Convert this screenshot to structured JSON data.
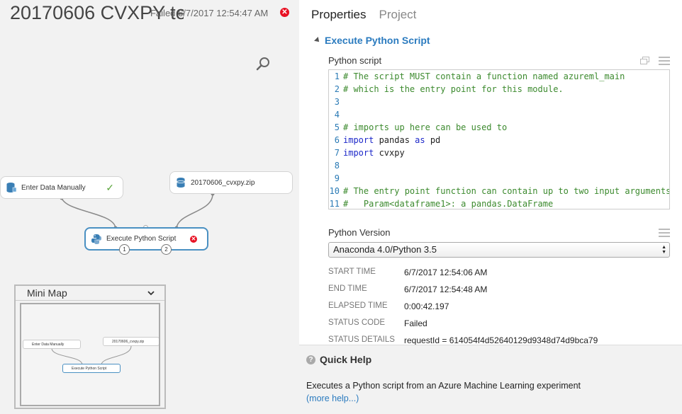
{
  "canvas": {
    "experiment_title": "20170606 CVXPY te..",
    "status_prefix": "Failed",
    "status_time": "6/7/2017 12:54:47 AM",
    "modules": {
      "enter_data": "Enter Data Manually",
      "zip": "20170606_cvxpy.zip",
      "execute": "Execute Python Script",
      "port1": "1",
      "port2": "2"
    },
    "minimap": {
      "title": "Mini Map",
      "enter_data": "Enter Data Manually",
      "zip": "20170606_cvxpy.zip",
      "execute": "Execute Python Script"
    }
  },
  "panel": {
    "tabs": [
      "Properties",
      "Project"
    ],
    "section_title": "Execute Python Script",
    "script_label": "Python script",
    "code_lines": [
      {
        "n": "1",
        "parts": [
          {
            "t": "cm",
            "v": "# The script MUST contain a function named azureml_main"
          }
        ]
      },
      {
        "n": "2",
        "parts": [
          {
            "t": "cm",
            "v": "# which is the entry point for this module."
          }
        ]
      },
      {
        "n": "3",
        "parts": []
      },
      {
        "n": "4",
        "parts": []
      },
      {
        "n": "5",
        "parts": [
          {
            "t": "cm",
            "v": "# imports up here can be used to"
          }
        ]
      },
      {
        "n": "6",
        "parts": [
          {
            "t": "kw",
            "v": "import"
          },
          {
            "t": "tx",
            "v": " pandas "
          },
          {
            "t": "kw",
            "v": "as"
          },
          {
            "t": "tx",
            "v": " pd"
          }
        ]
      },
      {
        "n": "7",
        "parts": [
          {
            "t": "kw",
            "v": "import"
          },
          {
            "t": "tx",
            "v": " cvxpy"
          }
        ]
      },
      {
        "n": "8",
        "parts": []
      },
      {
        "n": "9",
        "parts": []
      },
      {
        "n": "10",
        "parts": [
          {
            "t": "cm",
            "v": "# The entry point function can contain up to two input arguments:"
          }
        ]
      },
      {
        "n": "11",
        "parts": [
          {
            "t": "cm",
            "v": "#   Param<dataframe1>: a pandas.DataFrame"
          }
        ]
      }
    ],
    "version_label": "Python Version",
    "version_value": "Anaconda 4.0/Python 3.5",
    "meta": [
      {
        "key": "START TIME",
        "value": "6/7/2017 12:54:06 AM"
      },
      {
        "key": "END TIME",
        "value": "6/7/2017 12:54:48 AM"
      },
      {
        "key": "ELAPSED TIME",
        "value": "0:00:42.197"
      },
      {
        "key": "STATUS CODE",
        "value": "Failed"
      },
      {
        "key": "STATUS DETAILS",
        "value": "requestId = 614054f4d52640129d9348d74d9bca79"
      }
    ],
    "quick_help": {
      "title": "Quick Help",
      "description": "Executes a Python script from an Azure Machine Learning experiment",
      "link": "(more help...)"
    }
  },
  "colors": {
    "accent": "#2b7bbf",
    "error": "#e81123",
    "success": "#5aa53b",
    "comment": "#3c8a2e",
    "keyword": "#1d28c9"
  },
  "icons": [
    "error-icon",
    "zoom-icon",
    "dataset-icon",
    "python-icon",
    "check-icon",
    "chevron-down-icon",
    "collapse-triangle-icon",
    "popout-icon",
    "menu-icon",
    "help-icon"
  ]
}
